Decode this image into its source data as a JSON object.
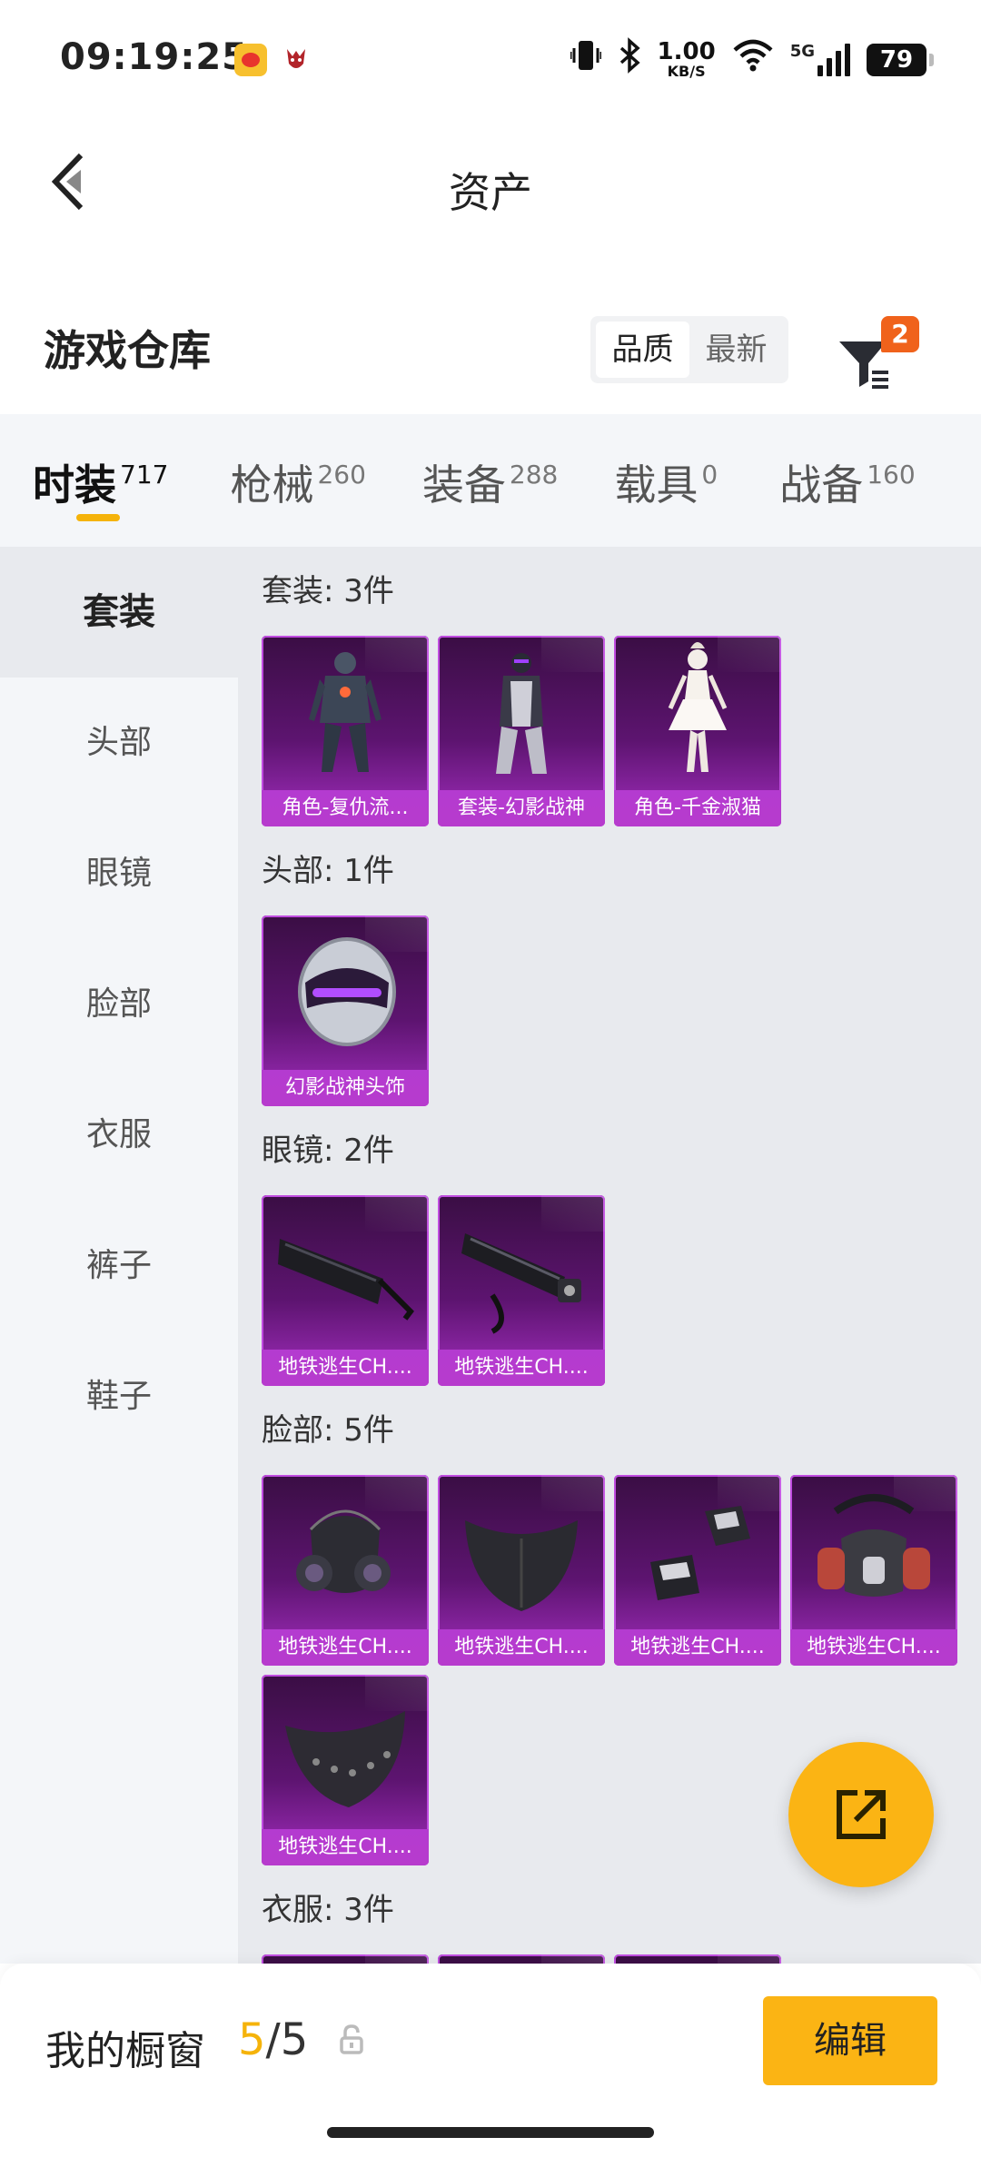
{
  "status_bar": {
    "time": "09:19:25",
    "net_speed": "1.00",
    "net_unit": "KB/S",
    "network_type": "5G",
    "battery": "79"
  },
  "nav": {
    "title": "资产",
    "back_icon": "chevron-left-icon"
  },
  "warehouse": {
    "title": "游戏仓库",
    "sort_options": [
      "品质",
      "最新"
    ],
    "sort_selected": "品质",
    "filter_badge": "2"
  },
  "tabs": [
    {
      "label": "时装",
      "count": "717",
      "active": true
    },
    {
      "label": "枪械",
      "count": "260",
      "active": false
    },
    {
      "label": "装备",
      "count": "288",
      "active": false
    },
    {
      "label": "载具",
      "count": "0",
      "active": false
    },
    {
      "label": "战备",
      "count": "160",
      "active": false
    }
  ],
  "sidebar": [
    {
      "label": "套装",
      "active": true
    },
    {
      "label": "头部",
      "active": false
    },
    {
      "label": "眼镜",
      "active": false
    },
    {
      "label": "脸部",
      "active": false
    },
    {
      "label": "衣服",
      "active": false
    },
    {
      "label": "裤子",
      "active": false
    },
    {
      "label": "鞋子",
      "active": false
    }
  ],
  "sections": [
    {
      "title": "套装: 3件",
      "items": [
        {
          "name": "角色-复仇流...",
          "icon": "armored-suit-icon"
        },
        {
          "name": "套装-幻影战神",
          "icon": "phantom-suit-icon"
        },
        {
          "name": "角色-千金淑猫",
          "icon": "white-dress-character-icon"
        }
      ]
    },
    {
      "title": "头部: 1件",
      "items": [
        {
          "name": "幻影战神头饰",
          "icon": "helmet-icon"
        }
      ]
    },
    {
      "title": "眼镜: 2件",
      "items": [
        {
          "name": "地铁逃生CH....",
          "icon": "sunglasses-icon"
        },
        {
          "name": "地铁逃生CH....",
          "icon": "tactical-glasses-icon"
        }
      ]
    },
    {
      "title": "脸部: 5件",
      "items": [
        {
          "name": "地铁逃生CH....",
          "icon": "gas-mask-icon"
        },
        {
          "name": "地铁逃生CH....",
          "icon": "face-mask-icon"
        },
        {
          "name": "地铁逃生CH....",
          "icon": "mouthpiece-icon"
        },
        {
          "name": "地铁逃生CH....",
          "icon": "respirator-icon"
        },
        {
          "name": "地铁逃生CH....",
          "icon": "spiked-mask-icon"
        }
      ]
    },
    {
      "title": "衣服: 3件",
      "items": [
        {
          "name": "",
          "icon": "clothing-icon"
        },
        {
          "name": "",
          "icon": "clothing-icon"
        },
        {
          "name": "",
          "icon": "clothing-icon"
        }
      ]
    }
  ],
  "bottom_bar": {
    "label": "我的橱窗",
    "current": "5",
    "separator": "/",
    "max": "5",
    "edit_label": "编辑"
  },
  "colors": {
    "accent": "#fbb414",
    "card_purple": "#5d1470",
    "badge": "#f0621b"
  }
}
